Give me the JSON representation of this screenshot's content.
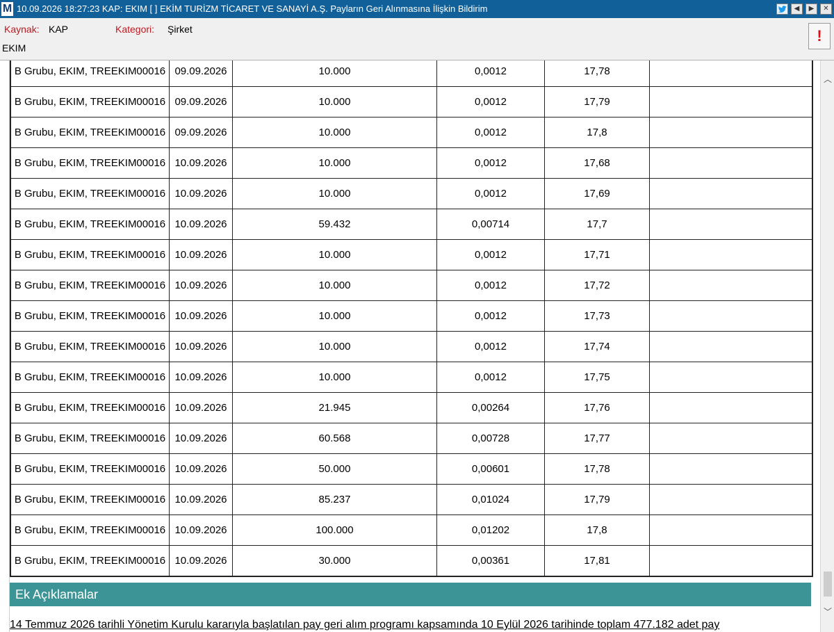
{
  "titlebar": {
    "logo": "M",
    "text": "10.09.2026 18:27:23 KAP: EKIM  [ ] EKİM TURİZM TİCARET VE SANAYİ A.Ş.  Payların Geri Alınmasına İlişkin Bildirim"
  },
  "header": {
    "source_label": "Kaynak:",
    "source_value": "KAP",
    "category_label": "Kategori:",
    "category_value": "Şirket",
    "ticker": "EKIM",
    "alert_symbol": "!"
  },
  "table": {
    "rows": [
      {
        "pay": "B Grubu, EKIM, TREEKIM00016",
        "date": "09.09.2026",
        "amount": "10.000",
        "ratio": "0,0012",
        "price": "17,78",
        "note": ""
      },
      {
        "pay": "B Grubu, EKIM, TREEKIM00016",
        "date": "09.09.2026",
        "amount": "10.000",
        "ratio": "0,0012",
        "price": "17,79",
        "note": ""
      },
      {
        "pay": "B Grubu, EKIM, TREEKIM00016",
        "date": "09.09.2026",
        "amount": "10.000",
        "ratio": "0,0012",
        "price": "17,8",
        "note": ""
      },
      {
        "pay": "B Grubu, EKIM, TREEKIM00016",
        "date": "10.09.2026",
        "amount": "10.000",
        "ratio": "0,0012",
        "price": "17,68",
        "note": ""
      },
      {
        "pay": "B Grubu, EKIM, TREEKIM00016",
        "date": "10.09.2026",
        "amount": "10.000",
        "ratio": "0,0012",
        "price": "17,69",
        "note": ""
      },
      {
        "pay": "B Grubu, EKIM, TREEKIM00016",
        "date": "10.09.2026",
        "amount": "59.432",
        "ratio": "0,00714",
        "price": "17,7",
        "note": ""
      },
      {
        "pay": "B Grubu, EKIM, TREEKIM00016",
        "date": "10.09.2026",
        "amount": "10.000",
        "ratio": "0,0012",
        "price": "17,71",
        "note": ""
      },
      {
        "pay": "B Grubu, EKIM, TREEKIM00016",
        "date": "10.09.2026",
        "amount": "10.000",
        "ratio": "0,0012",
        "price": "17,72",
        "note": ""
      },
      {
        "pay": "B Grubu, EKIM, TREEKIM00016",
        "date": "10.09.2026",
        "amount": "10.000",
        "ratio": "0,0012",
        "price": "17,73",
        "note": ""
      },
      {
        "pay": "B Grubu, EKIM, TREEKIM00016",
        "date": "10.09.2026",
        "amount": "10.000",
        "ratio": "0,0012",
        "price": "17,74",
        "note": ""
      },
      {
        "pay": "B Grubu, EKIM, TREEKIM00016",
        "date": "10.09.2026",
        "amount": "10.000",
        "ratio": "0,0012",
        "price": "17,75",
        "note": ""
      },
      {
        "pay": "B Grubu, EKIM, TREEKIM00016",
        "date": "10.09.2026",
        "amount": "21.945",
        "ratio": "0,00264",
        "price": "17,76",
        "note": ""
      },
      {
        "pay": "B Grubu, EKIM, TREEKIM00016",
        "date": "10.09.2026",
        "amount": "60.568",
        "ratio": "0,00728",
        "price": "17,77",
        "note": ""
      },
      {
        "pay": "B Grubu, EKIM, TREEKIM00016",
        "date": "10.09.2026",
        "amount": "50.000",
        "ratio": "0,00601",
        "price": "17,78",
        "note": ""
      },
      {
        "pay": "B Grubu, EKIM, TREEKIM00016",
        "date": "10.09.2026",
        "amount": "85.237",
        "ratio": "0,01024",
        "price": "17,79",
        "note": ""
      },
      {
        "pay": "B Grubu, EKIM, TREEKIM00016",
        "date": "10.09.2026",
        "amount": "100.000",
        "ratio": "0,01202",
        "price": "17,8",
        "note": ""
      },
      {
        "pay": "B Grubu, EKIM, TREEKIM00016",
        "date": "10.09.2026",
        "amount": "30.000",
        "ratio": "0,00361",
        "price": "17,81",
        "note": ""
      }
    ]
  },
  "section": {
    "title": "Ek Açıklamalar"
  },
  "bottom_text": "14 Temmuz 2026 tarihli Yönetim Kurulu kararıyla başlatılan pay geri alım programı kapsamında 10 Eylül 2026 tarihinde toplam 477.182 adet pay",
  "icons": {
    "twitter": "twitter-icon",
    "prev": "arrow-left-icon",
    "next": "arrow-right-icon",
    "close": "close-icon"
  },
  "colors": {
    "titlebar": "#11609a",
    "section_bar": "#3d9496",
    "label_red": "#c0171f"
  }
}
